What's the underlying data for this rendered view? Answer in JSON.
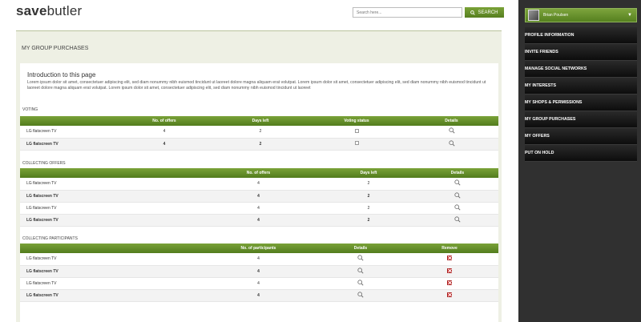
{
  "header": {
    "logo_bold": "save",
    "logo_rest": "butler",
    "search_placeholder": "Search here...",
    "search_label": "SEARCH"
  },
  "user": {
    "name": "Brian Poulsen"
  },
  "sidebar": {
    "items": [
      {
        "label": "PROFILE INFORMATION"
      },
      {
        "label": "INVITE FRIENDS"
      },
      {
        "label": "MANAGE SOCIAL NETWORKS"
      },
      {
        "label": "MY INTERESTS"
      },
      {
        "label": "MY SHOPS & PERMISSIONS"
      },
      {
        "label": "MY GROUP PURCHASES"
      },
      {
        "label": "MY OFFERS"
      },
      {
        "label": "PUT ON HOLD"
      }
    ]
  },
  "main": {
    "title": "MY GROUP PURCHASES",
    "intro_heading": "Introduction to this page",
    "intro_text": "Lorem ipsum dolor sit amet, consectetuer adipiscing elit, sed diam nonummy nibh euismod tincidunt ut laoreet dolore magna aliquam erat volutpat. Lorem ipsum dolor sit amet, consectetuer adipiscing elit, sed diam nonummy nibh euismod tincidunt ut laoreet dolore magna aliquam erat volutpat. Lorem ipsum dolor sit amet, consectetuer adipiscing elit, sed diam nonummy nibh euismod tincidunt ut laoreet",
    "voting": {
      "label": "VOTING",
      "headers": [
        "No. of offers",
        "Days left",
        "Voting status",
        "Details"
      ],
      "rows": [
        {
          "name": "LG flatscreen TV",
          "offers": "4",
          "days": "2"
        },
        {
          "name": "LG flatscreen TV",
          "offers": "4",
          "days": "2"
        }
      ]
    },
    "collecting_offers": {
      "label": "COLLECTING OFFERS",
      "headers": [
        "No. of offers",
        "Days left",
        "Details"
      ],
      "rows": [
        {
          "name": "LG flatscreen TV",
          "offers": "4",
          "days": "2"
        },
        {
          "name": "LG flatscreen TV",
          "offers": "4",
          "days": "2"
        },
        {
          "name": "LG flatscreen TV",
          "offers": "4",
          "days": "2"
        },
        {
          "name": "LG flatscreen TV",
          "offers": "4",
          "days": "2"
        }
      ]
    },
    "collecting_participants": {
      "label": "COLLECTING PARTICIPANTS",
      "headers": [
        "No. of participants",
        "Details",
        "Remove"
      ],
      "rows": [
        {
          "name": "LG flatscreen TV",
          "participants": "4"
        },
        {
          "name": "LG flatscreen TV",
          "participants": "4"
        },
        {
          "name": "LG flatscreen TV",
          "participants": "4"
        },
        {
          "name": "LG flatscreen TV",
          "participants": "4"
        }
      ]
    }
  }
}
